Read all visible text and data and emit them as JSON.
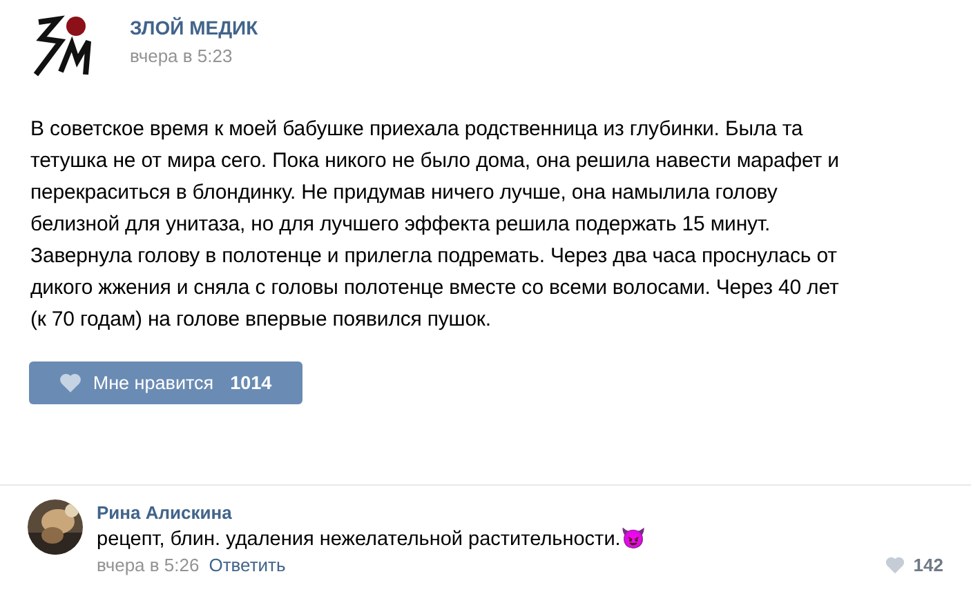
{
  "post": {
    "author": "ЗЛОЙ МЕДИК",
    "time": "вчера в 5:23",
    "text_lines": [
      "В советское время к моей бабушке приехала родственница из глубинки. Была та",
      "тетушка не от мира сего. Пока никого не было дома, она решила навести марафет и",
      "перекраситься в блондинку. Не придумав ничего лучше, она намылила голову",
      "белизной для унитаза, но для лучшего эффекта решила подержать 15 минут.",
      "Завернула голову в полотенце и прилегла подремать. Через два часа проснулась от",
      "дикого жжения и сняла с головы полотенце вместе со всеми волосами. Через 40 лет",
      "(к 70 годам) на голове впервые появился пушок."
    ],
    "like_button": {
      "label": "Мне нравится",
      "count": "1014",
      "liked": false
    }
  },
  "comment": {
    "author": "Рина Алискина",
    "text": "рецепт, блин. удаления нежелательной растительности.",
    "emoji": "😈",
    "time": "вчера в 5:26",
    "reply": "Ответить",
    "likes": "142"
  }
}
